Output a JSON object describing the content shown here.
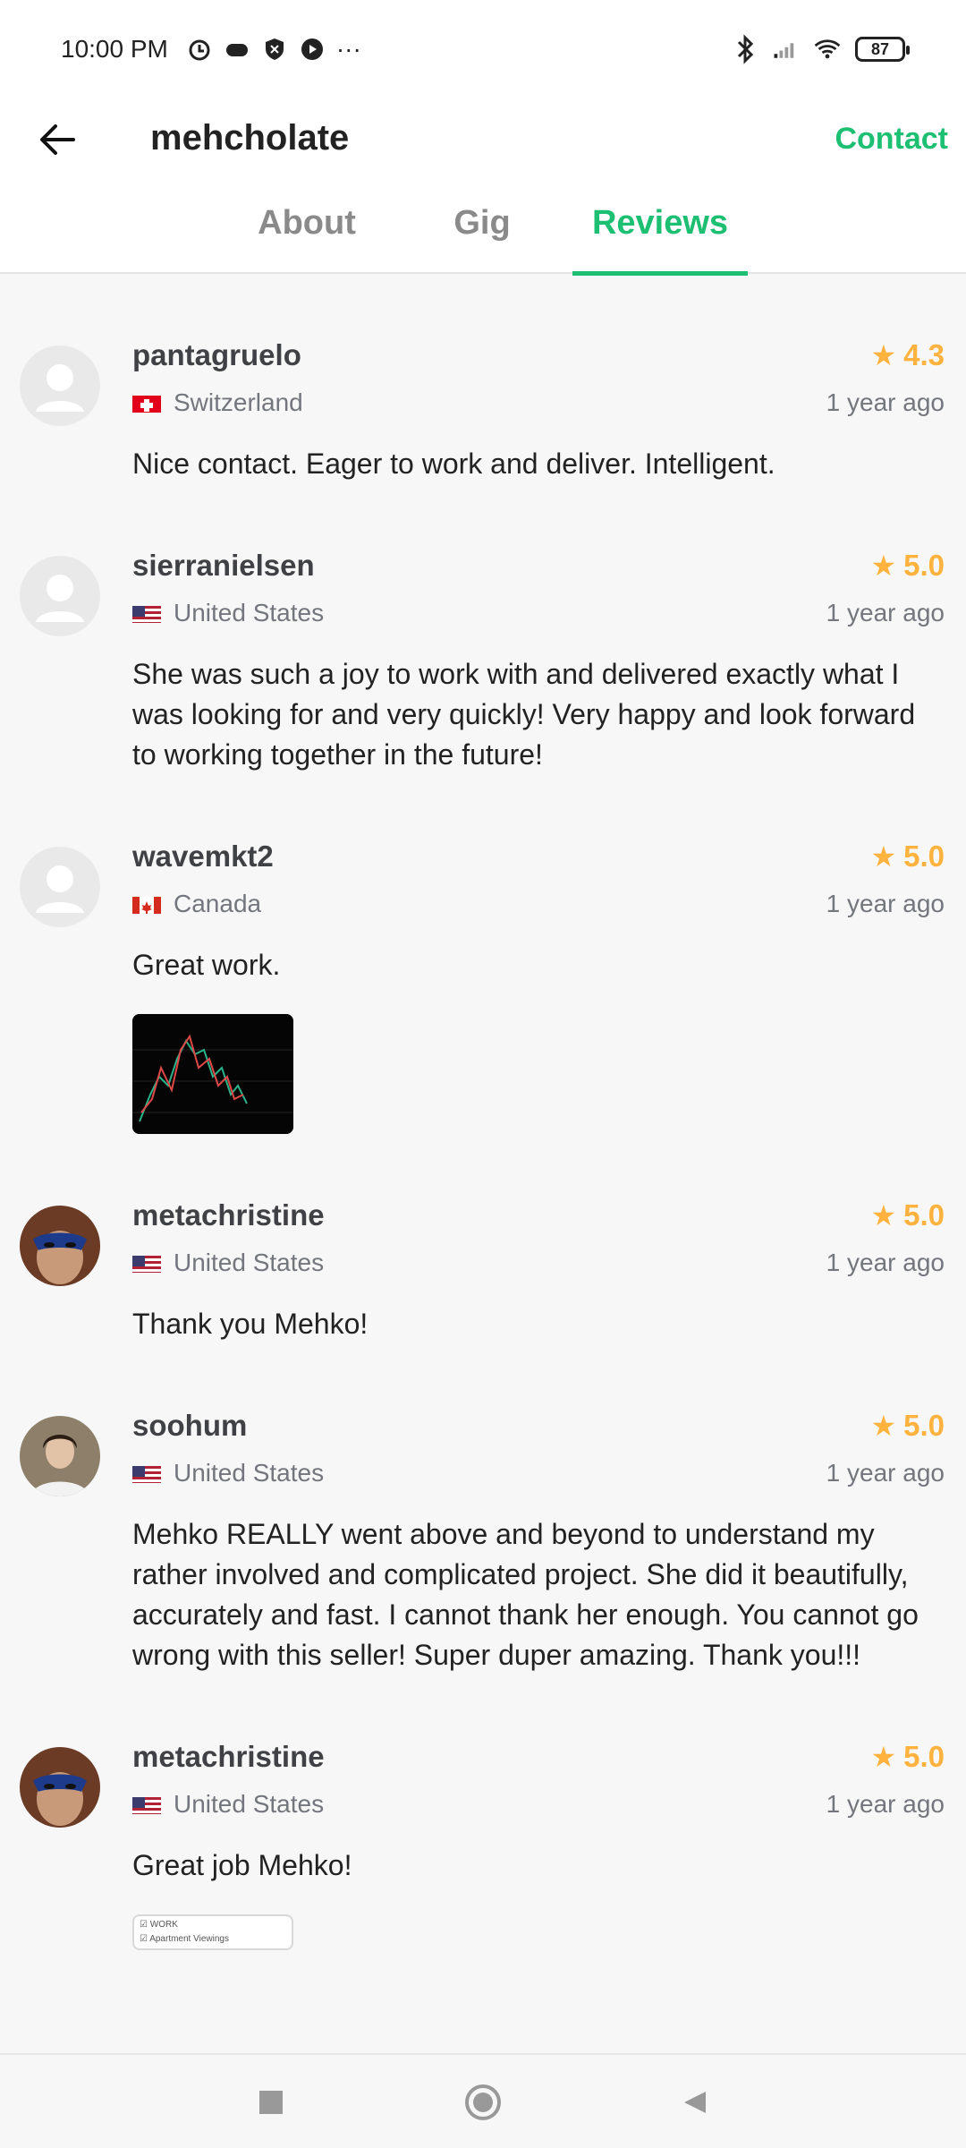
{
  "status_bar": {
    "time": "10:00 PM",
    "overflow": "···",
    "battery": "87"
  },
  "header": {
    "title": "mehcholate",
    "contact_label": "Contact"
  },
  "tabs": [
    {
      "label": "About",
      "active": false
    },
    {
      "label": "Gig",
      "active": false
    },
    {
      "label": "Reviews",
      "active": true
    }
  ],
  "reviews": [
    {
      "name": "pantagruelo",
      "country": "Switzerland",
      "rating": "4.3",
      "time": "1 year ago",
      "text": "Nice contact. Eager to work and deliver. Intelligent."
    },
    {
      "name": "sierranielsen",
      "country": "United States",
      "rating": "5.0",
      "time": "1 year ago",
      "text": "She was such a joy to work with and delivered exactly what I was looking for and very quickly! Very happy and look forward to working together in the future!"
    },
    {
      "name": "wavemkt2",
      "country": "Canada",
      "rating": "5.0",
      "time": "1 year ago",
      "text": "Great work."
    },
    {
      "name": "metachristine",
      "country": "United States",
      "rating": "5.0",
      "time": "1 year ago",
      "text": "Thank you Mehko!"
    },
    {
      "name": "soohum",
      "country": "United States",
      "rating": "5.0",
      "time": "1 year ago",
      "text": "Mehko REALLY went above and beyond to understand my rather involved and complicated project. She did it beautifully, accurately and fast. I cannot thank her enough. You cannot go wrong with this seller! Super duper amazing. Thank you!!!"
    },
    {
      "name": "metachristine",
      "country": "United States",
      "rating": "5.0",
      "time": "1 year ago",
      "text": "Great job Mehko!"
    }
  ],
  "attachment_labels": {
    "work": "WORK",
    "apartment": "Apartment Viewings"
  },
  "colors": {
    "accent": "#1dbf73",
    "star": "#ffb33e",
    "muted": "#74767e"
  }
}
